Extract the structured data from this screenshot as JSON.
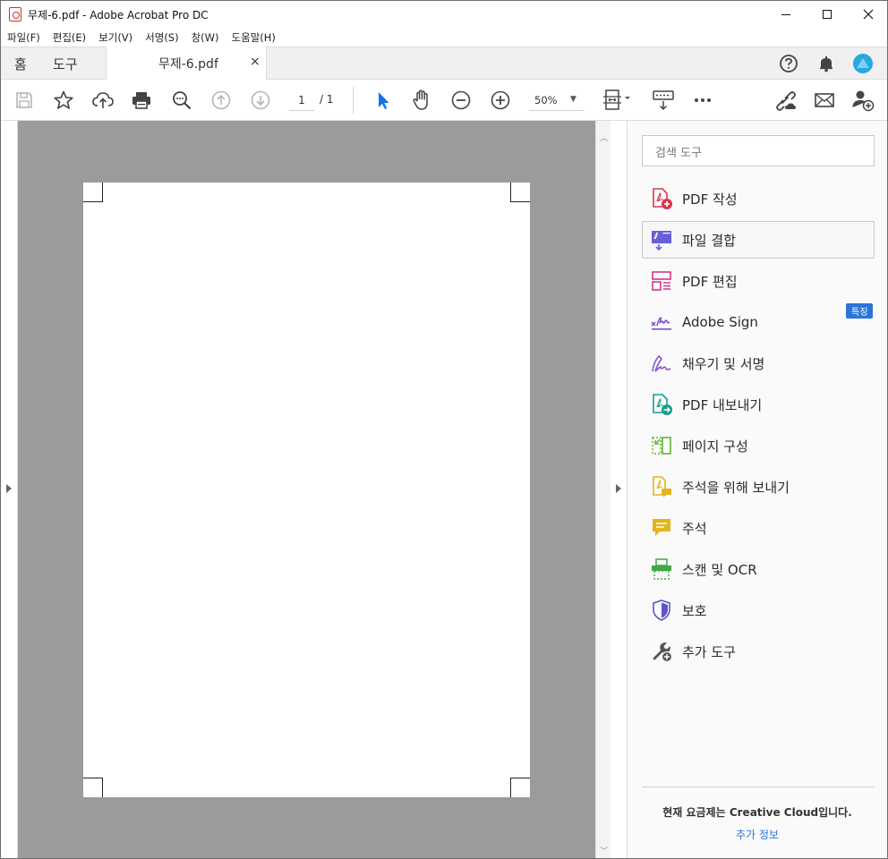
{
  "window": {
    "title": "무제-6.pdf - Adobe Acrobat Pro DC"
  },
  "menu": [
    "파일(F)",
    "편집(E)",
    "보기(V)",
    "서명(S)",
    "창(W)",
    "도움말(H)"
  ],
  "tabs": {
    "home": "홈",
    "tools": "도구",
    "document": "무제-6.pdf",
    "close_glyph": "×"
  },
  "toolbar": {
    "page_current": "1",
    "page_total": "/  1",
    "zoom": "50%"
  },
  "tools_pane": {
    "search_placeholder": "검색 도구",
    "items": [
      {
        "label": "PDF 작성",
        "icon": "create-pdf-icon",
        "color": "#d8364b"
      },
      {
        "label": "파일 결합",
        "icon": "combine-files-icon",
        "color": "#6a5fd8"
      },
      {
        "label": "PDF 편집",
        "icon": "edit-pdf-icon",
        "color": "#d6358c"
      },
      {
        "label": "Adobe Sign",
        "icon": "adobe-sign-icon",
        "color": "#7b4dd1"
      },
      {
        "label": "채우기 및 서명",
        "icon": "fill-sign-icon",
        "color": "#8a4fd6"
      },
      {
        "label": "PDF 내보내기",
        "icon": "export-pdf-icon",
        "color": "#1b9c8d"
      },
      {
        "label": "페이지 구성",
        "icon": "organize-pages-icon",
        "color": "#5fb336"
      },
      {
        "label": "주석을 위해 보내기",
        "icon": "send-for-comments-icon",
        "color": "#e3b51b"
      },
      {
        "label": "주석",
        "icon": "comment-icon",
        "color": "#e3b51b"
      },
      {
        "label": "스캔 및 OCR",
        "icon": "scan-ocr-icon",
        "color": "#3fa84a"
      },
      {
        "label": "보호",
        "icon": "protect-icon",
        "color": "#5b55c9"
      },
      {
        "label": "추가 도구",
        "icon": "more-tools-icon",
        "color": "#555555"
      }
    ],
    "badge": "특징",
    "plan_text": "현재 요금제는 Creative Cloud입니다.",
    "more_info": "추가 정보"
  },
  "colors": {
    "accent": "#2d74da",
    "viewer_bg": "#9b9b9b"
  }
}
